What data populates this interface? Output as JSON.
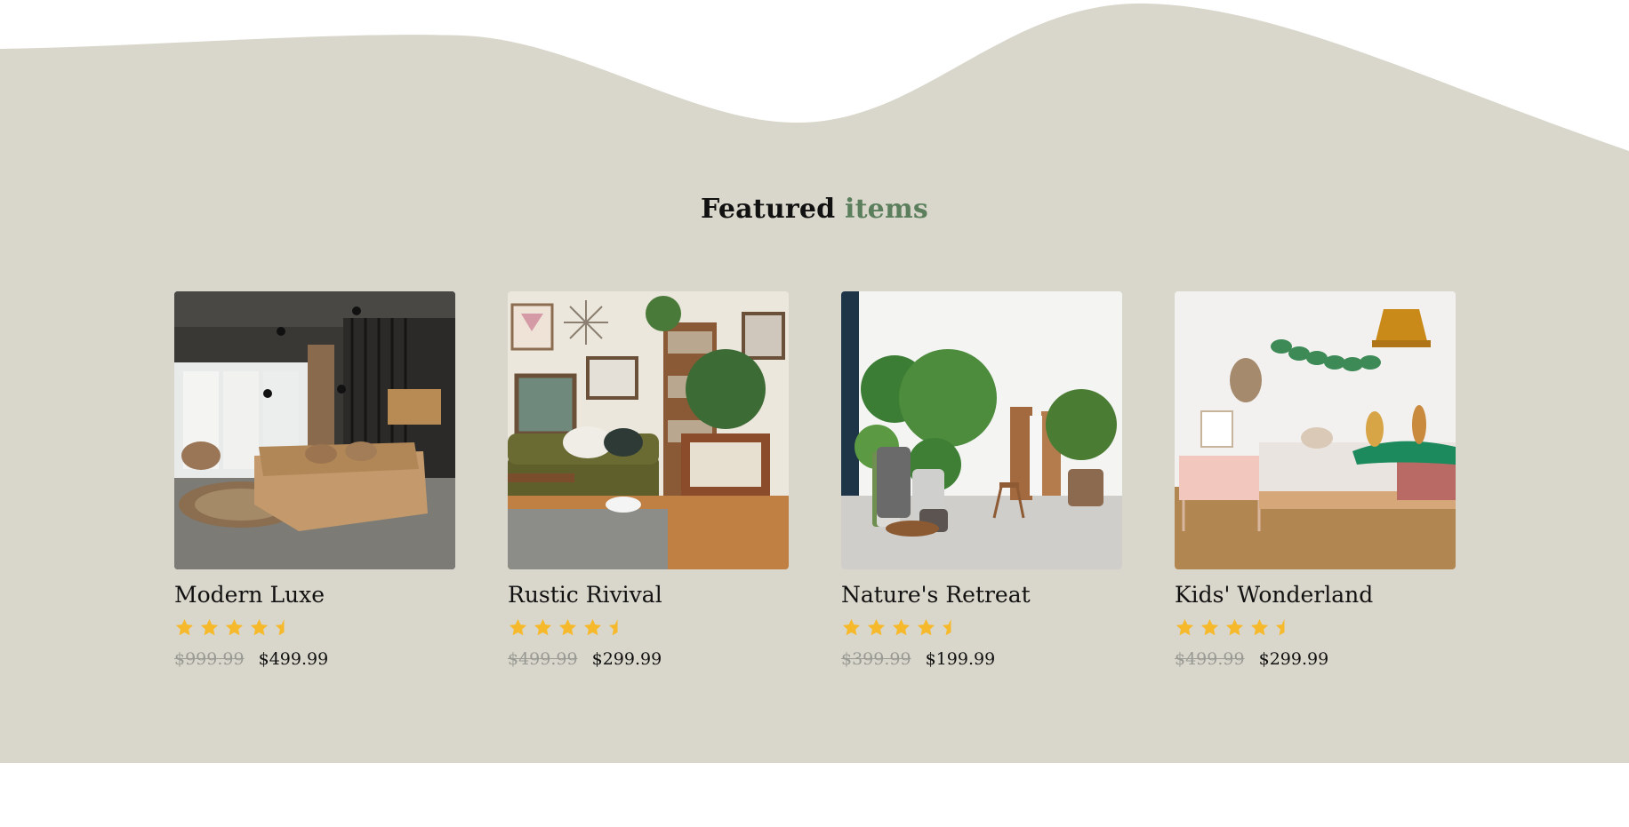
{
  "section": {
    "title_main": "Featured",
    "title_accent": "items",
    "bg_color": "#d9d7cb",
    "accent_color": "#5b7f5c",
    "star_color": "#f6b92b"
  },
  "products": [
    {
      "name": "Modern Luxe",
      "rating": 4.5,
      "old_price": "$999.99",
      "price": "$499.99",
      "image": "modern-living-room-photo"
    },
    {
      "name": "Rustic Rivival",
      "rating": 4.5,
      "old_price": "$499.99",
      "price": "$299.99",
      "image": "rustic-living-room-photo"
    },
    {
      "name": "Nature's Retreat",
      "rating": 4.5,
      "old_price": "$399.99",
      "price": "$199.99",
      "image": "plants-room-photo"
    },
    {
      "name": "Kids' Wonderland",
      "rating": 4.5,
      "old_price": "$499.99",
      "price": "$299.99",
      "image": "kids-bedroom-photo"
    }
  ]
}
